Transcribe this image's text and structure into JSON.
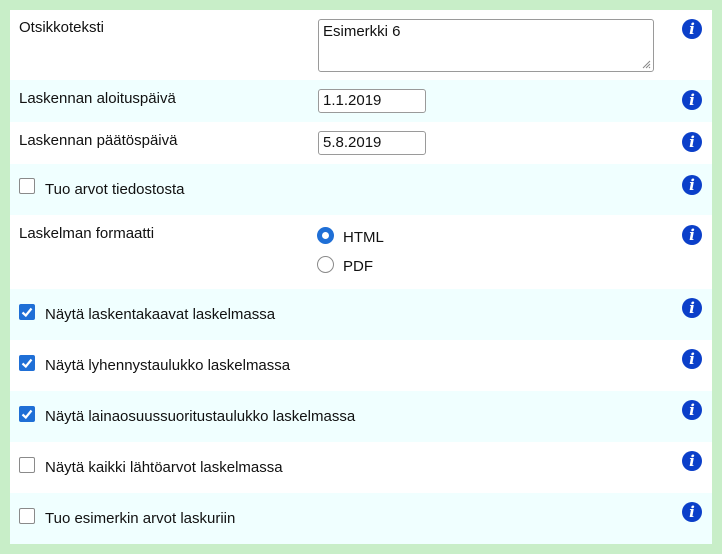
{
  "form": {
    "title_row": {
      "label": "Otsikkoteksti",
      "value": "Esimerkki 6"
    },
    "start_row": {
      "label": "Laskennan aloituspäivä",
      "value": "1.1.2019"
    },
    "end_row": {
      "label": "Laskennan päätöspäivä",
      "value": "5.8.2019"
    },
    "import_file": {
      "label": "Tuo arvot tiedostosta",
      "checked": false
    },
    "format": {
      "label": "Laskelman formaatti",
      "options": [
        {
          "label": "HTML",
          "selected": true
        },
        {
          "label": "PDF",
          "selected": false
        }
      ]
    },
    "show_formulas": {
      "label": "Näytä laskentakaavat laskelmassa",
      "checked": true
    },
    "show_shortening": {
      "label": "Näytä lyhennystaulukko laskelmassa",
      "checked": true
    },
    "show_loan_share": {
      "label": "Näytä lainaosuussuoritustaulukko laskelmassa",
      "checked": true
    },
    "show_all_inputs": {
      "label": "Näytä kaikki lähtöarvot laskelmassa",
      "checked": false
    },
    "import_example": {
      "label": "Tuo esimerkin arvot laskuriin",
      "checked": false
    }
  },
  "info_icon": {
    "glyph": "i",
    "color": "#0b3fc9"
  },
  "colors": {
    "page_bg": "#c8eec8",
    "row_alt": "#f0ffff",
    "accent": "#1f6fd6"
  }
}
